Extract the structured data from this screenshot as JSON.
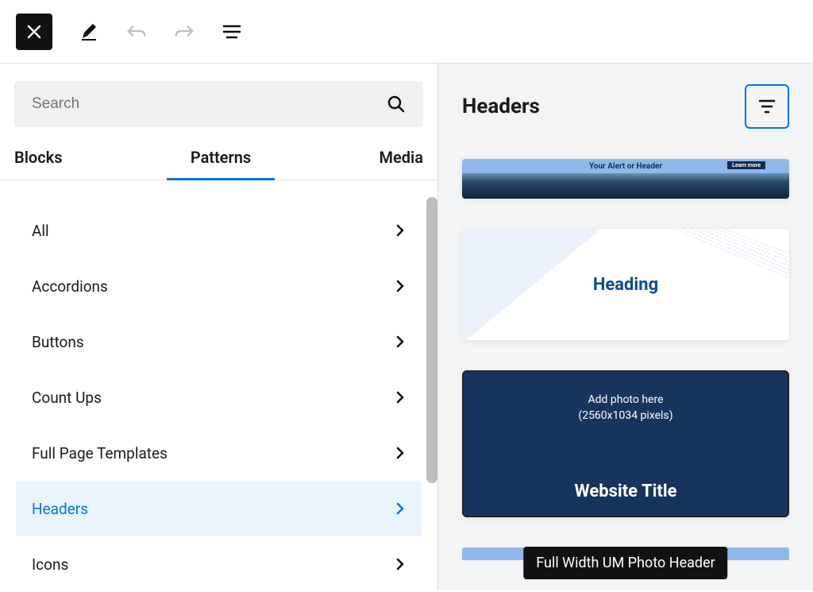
{
  "toolbar": {
    "close": "Close",
    "edit": "Edit",
    "undo": "Undo",
    "redo": "Redo",
    "view": "View options"
  },
  "search": {
    "placeholder": "Search"
  },
  "tabs": {
    "blocks": "Blocks",
    "patterns": "Patterns",
    "media": "Media",
    "active": "patterns"
  },
  "categories": [
    {
      "label": "All",
      "selected": false
    },
    {
      "label": "Accordions",
      "selected": false
    },
    {
      "label": "Buttons",
      "selected": false
    },
    {
      "label": "Count Ups",
      "selected": false
    },
    {
      "label": "Full Page Templates",
      "selected": false
    },
    {
      "label": "Headers",
      "selected": true
    },
    {
      "label": "Icons",
      "selected": false
    }
  ],
  "preview": {
    "title": "Headers",
    "filter_label": "Filter",
    "patterns": {
      "alert": {
        "text": "Your Alert or Header",
        "button": "Learn more"
      },
      "heading": {
        "text": "Heading"
      },
      "photo": {
        "line1": "Add photo here",
        "line2": "(2560x1034 pixels)",
        "title": "Website Title"
      }
    },
    "tooltip": "Full Width UM Photo Header"
  }
}
